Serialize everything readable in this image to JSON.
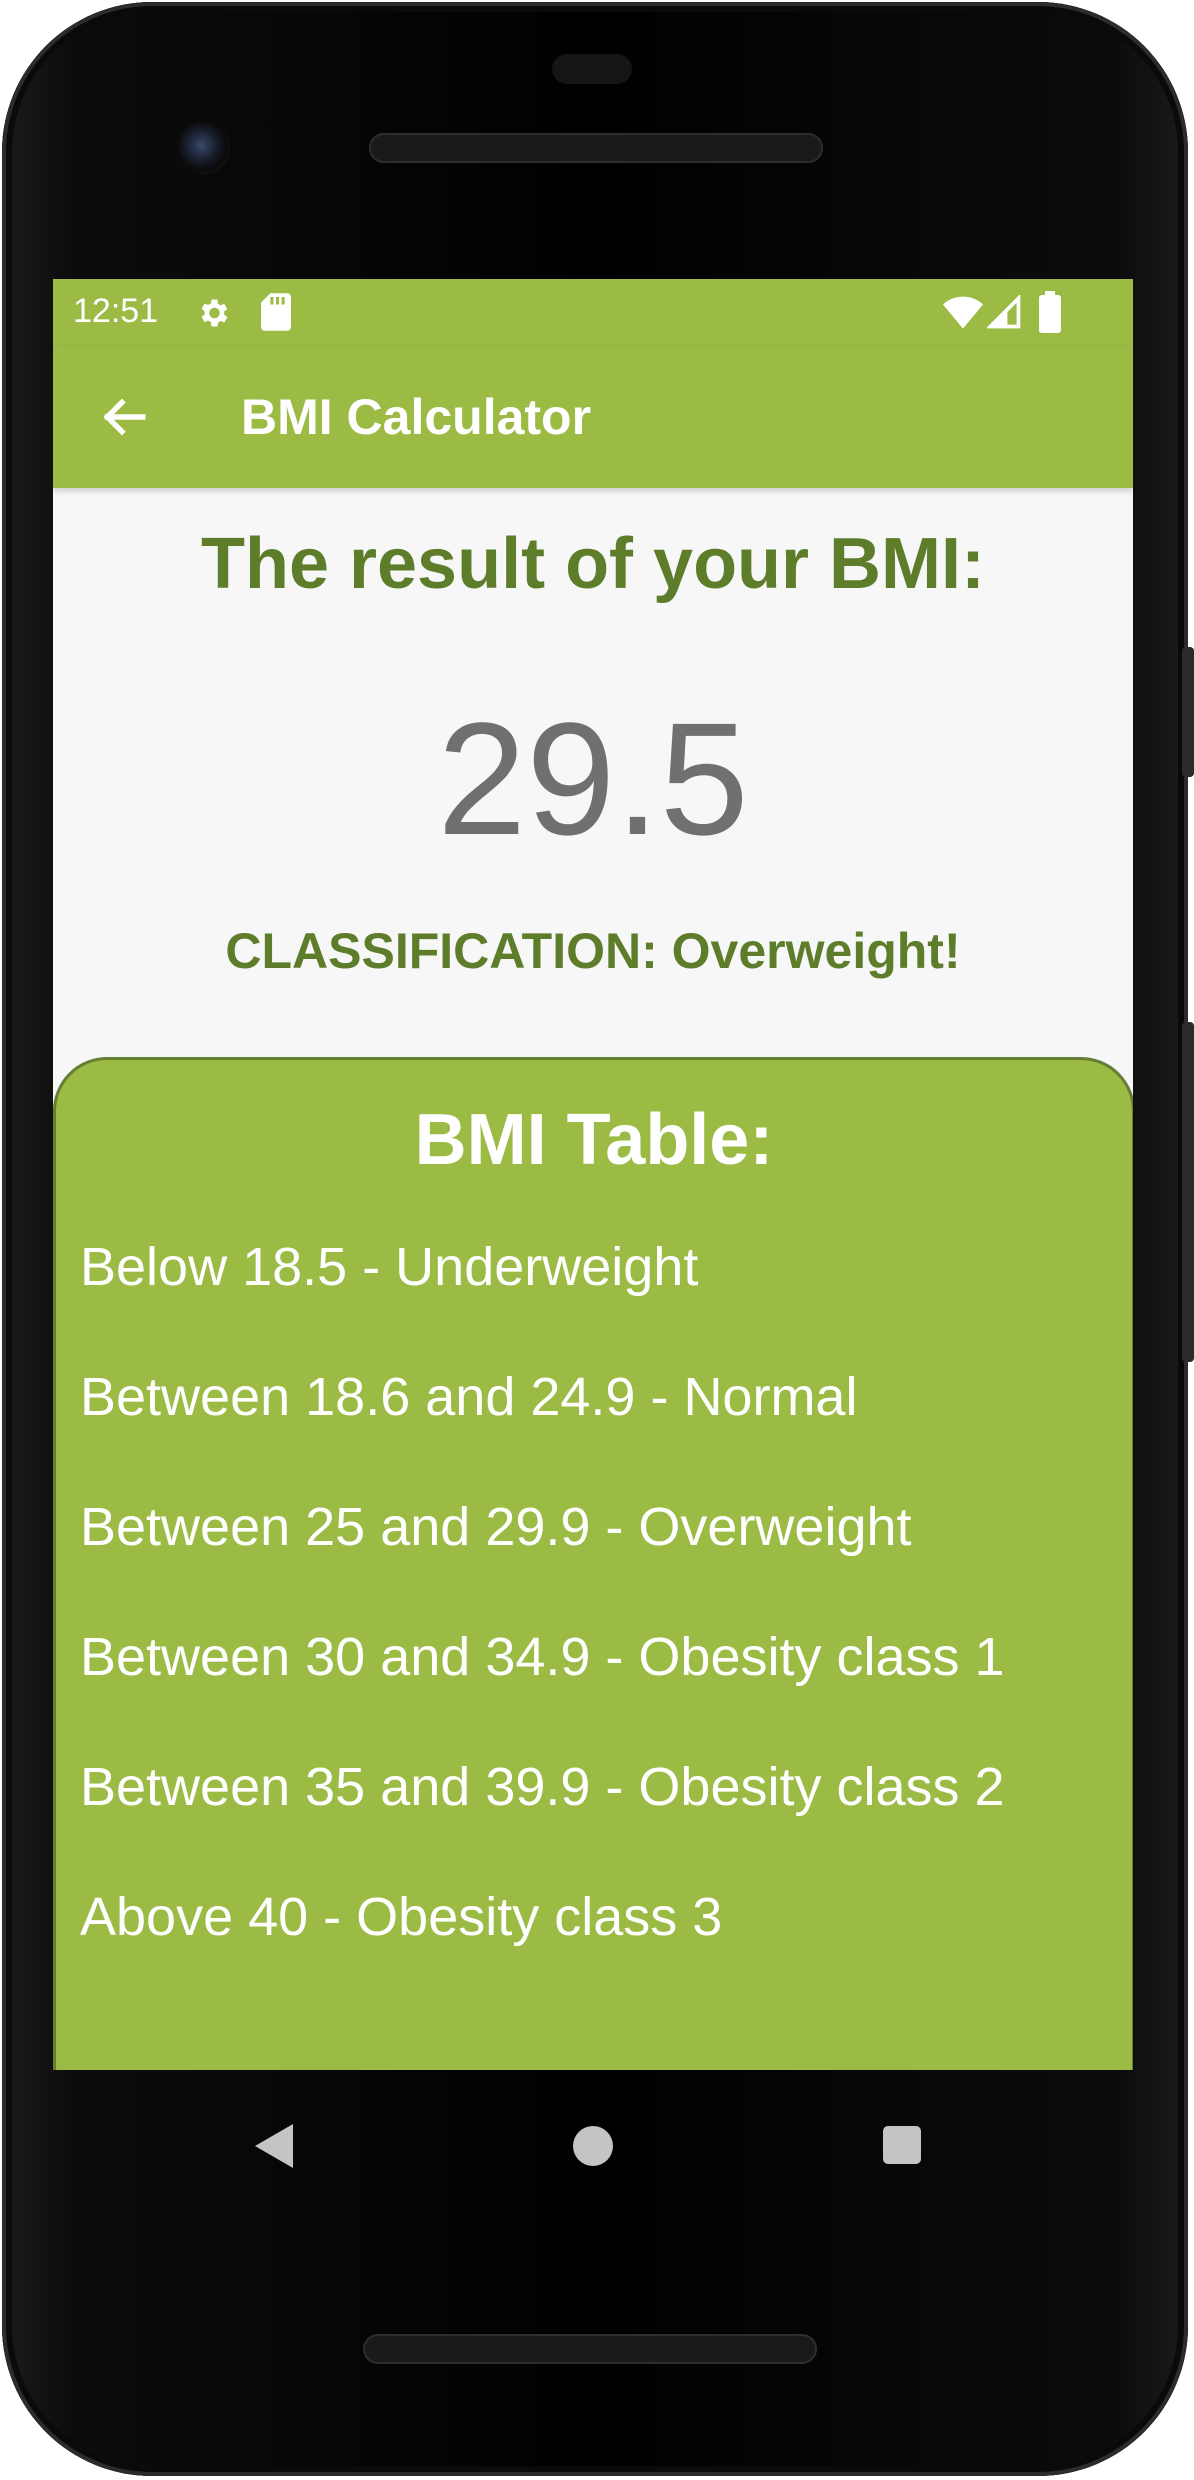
{
  "status_bar": {
    "time": "12:51",
    "left_icons": [
      "gear-icon",
      "sd-card-icon"
    ],
    "right_icons": [
      "wifi-icon",
      "cell-signal-icon",
      "battery-icon"
    ]
  },
  "app_bar": {
    "title": "BMI Calculator",
    "back_icon": "arrow-left-icon"
  },
  "result": {
    "heading": "The result of your BMI:",
    "value": "29.5",
    "classification": "CLASSIFICATION: Overweight!"
  },
  "bmi_table": {
    "title": "BMI Table:",
    "rows": [
      "Below 18.5 - Underweight",
      "Between 18.6 and 24.9 - Normal",
      "Between 25 and 29.9 - Overweight",
      "Between 30 and 34.9 - Obesity class 1",
      "Between 35 and 39.9 - Obesity class 2",
      "Above 40 - Obesity class 3"
    ]
  },
  "nav_bar": {
    "icons": [
      "nav-back-icon",
      "nav-home-icon",
      "nav-recents-icon"
    ]
  },
  "colors": {
    "primary_green": "#9bbb45",
    "dark_green_text": "#5e7d2b",
    "card_border": "#647e34",
    "value_gray": "#707070",
    "background": "#f7f7f7"
  }
}
